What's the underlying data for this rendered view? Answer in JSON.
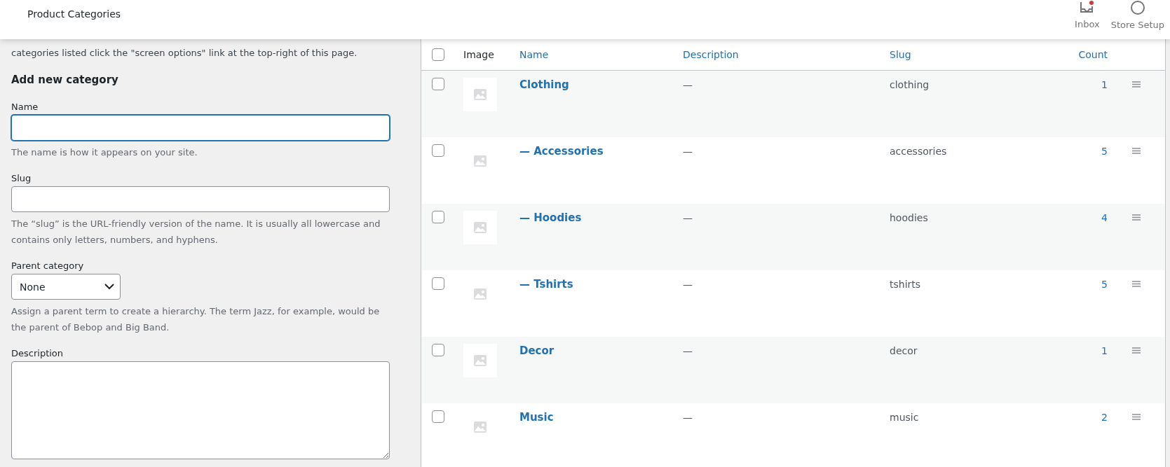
{
  "header": {
    "title": "Product Categories",
    "actions": [
      {
        "kind": "inbox",
        "label": "Inbox",
        "unread": true
      },
      {
        "kind": "setup",
        "label": "Store Setup"
      }
    ]
  },
  "intro": "categories listed click the \"screen options\" link at the top-right of this page.",
  "form": {
    "heading": "Add new category",
    "fields": [
      {
        "kind": "text",
        "label": "Name",
        "focused": true,
        "help": "The name is how it appears on your site."
      },
      {
        "kind": "text",
        "label": "Slug",
        "focused": false,
        "help": "The “slug” is the URL-friendly version of the name. It is usually all lowercase and contains only letters, numbers, and hyphens."
      },
      {
        "kind": "select",
        "label": "Parent category",
        "value": "None",
        "help": "Assign a parent term to create a hierarchy. The term Jazz, for example, would be the parent of Bebop and Big Band."
      },
      {
        "kind": "textarea",
        "label": "Description"
      }
    ]
  },
  "table": {
    "select_all_checked": false,
    "columns": [
      "Image",
      "Name",
      "Description",
      "Slug",
      "Count"
    ],
    "rows": [
      {
        "name": "Clothing",
        "description": "—",
        "slug": "clothing",
        "count": "1",
        "checked": false
      },
      {
        "name": "— Accessories",
        "description": "—",
        "slug": "accessories",
        "count": "5",
        "checked": false
      },
      {
        "name": "— Hoodies",
        "description": "—",
        "slug": "hoodies",
        "count": "4",
        "checked": false
      },
      {
        "name": "— Tshirts",
        "description": "—",
        "slug": "tshirts",
        "count": "5",
        "checked": false
      },
      {
        "name": "Decor",
        "description": "—",
        "slug": "decor",
        "count": "1",
        "checked": false
      },
      {
        "name": "Music",
        "description": "—",
        "slug": "music",
        "count": "2",
        "checked": false
      }
    ]
  }
}
